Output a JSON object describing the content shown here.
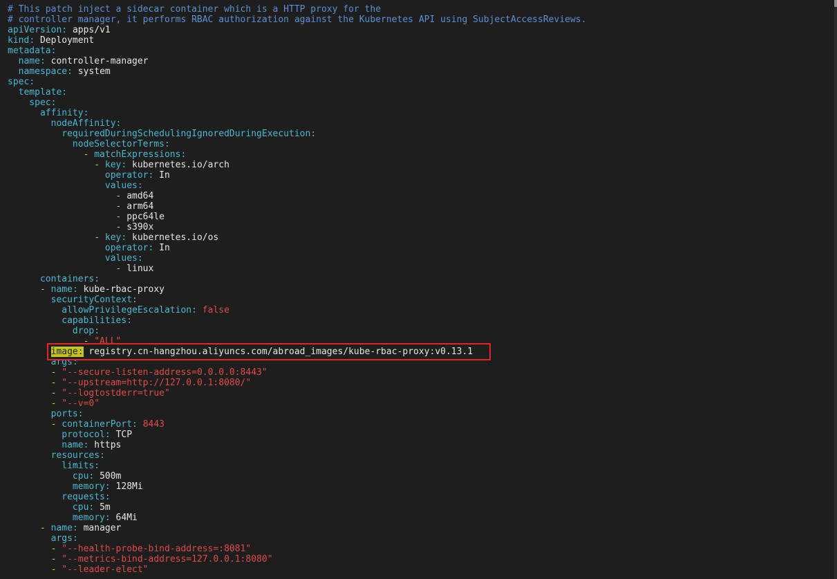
{
  "lines": [
    [
      {
        "t": "# This patch inject a sidecar container which is a HTTP proxy for the",
        "c": "cmt"
      }
    ],
    [
      {
        "t": "# controller manager, it performs RBAC authorization against the Kubernetes API using SubjectAccessReviews.",
        "c": "cmt"
      }
    ],
    [
      {
        "t": "apiVersion",
        "c": "key"
      },
      {
        "t": ": ",
        "c": "key"
      },
      {
        "t": "apps/v1",
        "c": "val"
      }
    ],
    [
      {
        "t": "kind",
        "c": "key"
      },
      {
        "t": ": ",
        "c": "key"
      },
      {
        "t": "Deployment",
        "c": "val"
      }
    ],
    [
      {
        "t": "metadata",
        "c": "key"
      },
      {
        "t": ":",
        "c": "key"
      }
    ],
    [
      {
        "t": "  "
      },
      {
        "t": "name",
        "c": "key"
      },
      {
        "t": ": ",
        "c": "key"
      },
      {
        "t": "controller-manager",
        "c": "val"
      }
    ],
    [
      {
        "t": "  "
      },
      {
        "t": "namespace",
        "c": "key"
      },
      {
        "t": ": ",
        "c": "key"
      },
      {
        "t": "system",
        "c": "val"
      }
    ],
    [
      {
        "t": "spec",
        "c": "key"
      },
      {
        "t": ":",
        "c": "key"
      }
    ],
    [
      {
        "t": "  "
      },
      {
        "t": "template",
        "c": "key"
      },
      {
        "t": ":",
        "c": "key"
      }
    ],
    [
      {
        "t": "    "
      },
      {
        "t": "spec",
        "c": "key"
      },
      {
        "t": ":",
        "c": "key"
      }
    ],
    [
      {
        "t": "      "
      },
      {
        "t": "affinity",
        "c": "key"
      },
      {
        "t": ":",
        "c": "key"
      }
    ],
    [
      {
        "t": "        "
      },
      {
        "t": "nodeAffinity",
        "c": "key"
      },
      {
        "t": ":",
        "c": "key"
      }
    ],
    [
      {
        "t": "          "
      },
      {
        "t": "requiredDuringSchedulingIgnoredDuringExecution",
        "c": "key"
      },
      {
        "t": ":",
        "c": "key"
      }
    ],
    [
      {
        "t": "            "
      },
      {
        "t": "nodeSelectorTerms",
        "c": "key"
      },
      {
        "t": ":",
        "c": "key"
      }
    ],
    [
      {
        "t": "              "
      },
      {
        "t": "- ",
        "c": "dash"
      },
      {
        "t": "matchExpressions",
        "c": "key"
      },
      {
        "t": ":",
        "c": "key"
      }
    ],
    [
      {
        "t": "                "
      },
      {
        "t": "- ",
        "c": "dash"
      },
      {
        "t": "key",
        "c": "key"
      },
      {
        "t": ": ",
        "c": "key"
      },
      {
        "t": "kubernetes.io/arch",
        "c": "val"
      }
    ],
    [
      {
        "t": "                  "
      },
      {
        "t": "operator",
        "c": "key"
      },
      {
        "t": ": ",
        "c": "key"
      },
      {
        "t": "In",
        "c": "val"
      }
    ],
    [
      {
        "t": "                  "
      },
      {
        "t": "values",
        "c": "key"
      },
      {
        "t": ":",
        "c": "key"
      }
    ],
    [
      {
        "t": "                    "
      },
      {
        "t": "- ",
        "c": "dash"
      },
      {
        "t": "amd64",
        "c": "val"
      }
    ],
    [
      {
        "t": "                    "
      },
      {
        "t": "- ",
        "c": "dash"
      },
      {
        "t": "arm64",
        "c": "val"
      }
    ],
    [
      {
        "t": "                    "
      },
      {
        "t": "- ",
        "c": "dash"
      },
      {
        "t": "ppc64le",
        "c": "val"
      }
    ],
    [
      {
        "t": "                    "
      },
      {
        "t": "- ",
        "c": "dash"
      },
      {
        "t": "s390x",
        "c": "val"
      }
    ],
    [
      {
        "t": "                "
      },
      {
        "t": "- ",
        "c": "dash"
      },
      {
        "t": "key",
        "c": "key"
      },
      {
        "t": ": ",
        "c": "key"
      },
      {
        "t": "kubernetes.io/os",
        "c": "val"
      }
    ],
    [
      {
        "t": "                  "
      },
      {
        "t": "operator",
        "c": "key"
      },
      {
        "t": ": ",
        "c": "key"
      },
      {
        "t": "In",
        "c": "val"
      }
    ],
    [
      {
        "t": "                  "
      },
      {
        "t": "values",
        "c": "key"
      },
      {
        "t": ":",
        "c": "key"
      }
    ],
    [
      {
        "t": "                    "
      },
      {
        "t": "- ",
        "c": "dash"
      },
      {
        "t": "linux",
        "c": "val"
      }
    ],
    [
      {
        "t": "      "
      },
      {
        "t": "containers",
        "c": "key"
      },
      {
        "t": ":",
        "c": "key"
      }
    ],
    [
      {
        "t": "      "
      },
      {
        "t": "- ",
        "c": "dash"
      },
      {
        "t": "name",
        "c": "key"
      },
      {
        "t": ": ",
        "c": "key"
      },
      {
        "t": "kube-rbac-proxy",
        "c": "val"
      }
    ],
    [
      {
        "t": "        "
      },
      {
        "t": "securityContext",
        "c": "key"
      },
      {
        "t": ":",
        "c": "key"
      }
    ],
    [
      {
        "t": "          "
      },
      {
        "t": "allowPrivilegeEscalation",
        "c": "key"
      },
      {
        "t": ": ",
        "c": "key"
      },
      {
        "t": "false",
        "c": "bool"
      }
    ],
    [
      {
        "t": "          "
      },
      {
        "t": "capabilities",
        "c": "key"
      },
      {
        "t": ":",
        "c": "key"
      }
    ],
    [
      {
        "t": "            "
      },
      {
        "t": "drop",
        "c": "key"
      },
      {
        "t": ":",
        "c": "key"
      }
    ],
    [
      {
        "t": "              "
      },
      {
        "t": "- ",
        "c": "dash"
      },
      {
        "t": "\"ALL\"",
        "c": "str"
      }
    ],
    [
      {
        "t": "        "
      },
      {
        "t": "image:",
        "c": "hl"
      },
      {
        "t": " "
      },
      {
        "t": "registry.cn-hangzhou.aliyuncs.com/abroad_images/kube-rbac-proxy:v0.13.1",
        "c": "val"
      }
    ],
    [
      {
        "t": "        "
      },
      {
        "t": "args",
        "c": "key"
      },
      {
        "t": ":",
        "c": "key"
      }
    ],
    [
      {
        "t": "        "
      },
      {
        "t": "- ",
        "c": "dash"
      },
      {
        "t": "\"--secure-listen-address=0.0.0.0:8443\"",
        "c": "str"
      }
    ],
    [
      {
        "t": "        "
      },
      {
        "t": "- ",
        "c": "dash"
      },
      {
        "t": "\"--upstream=http://127.0.0.1:8080/\"",
        "c": "str"
      }
    ],
    [
      {
        "t": "        "
      },
      {
        "t": "- ",
        "c": "dash"
      },
      {
        "t": "\"--logtostderr=true\"",
        "c": "str"
      }
    ],
    [
      {
        "t": "        "
      },
      {
        "t": "- ",
        "c": "dash"
      },
      {
        "t": "\"--v=0\"",
        "c": "str"
      }
    ],
    [
      {
        "t": "        "
      },
      {
        "t": "ports",
        "c": "key"
      },
      {
        "t": ":",
        "c": "key"
      }
    ],
    [
      {
        "t": "        "
      },
      {
        "t": "- ",
        "c": "dash"
      },
      {
        "t": "containerPort",
        "c": "key"
      },
      {
        "t": ": ",
        "c": "key"
      },
      {
        "t": "8443",
        "c": "num"
      }
    ],
    [
      {
        "t": "          "
      },
      {
        "t": "protocol",
        "c": "key"
      },
      {
        "t": ": ",
        "c": "key"
      },
      {
        "t": "TCP",
        "c": "val"
      }
    ],
    [
      {
        "t": "          "
      },
      {
        "t": "name",
        "c": "key"
      },
      {
        "t": ": ",
        "c": "key"
      },
      {
        "t": "https",
        "c": "val"
      }
    ],
    [
      {
        "t": "        "
      },
      {
        "t": "resources",
        "c": "key"
      },
      {
        "t": ":",
        "c": "key"
      }
    ],
    [
      {
        "t": "          "
      },
      {
        "t": "limits",
        "c": "key"
      },
      {
        "t": ":",
        "c": "key"
      }
    ],
    [
      {
        "t": "            "
      },
      {
        "t": "cpu",
        "c": "key"
      },
      {
        "t": ": ",
        "c": "key"
      },
      {
        "t": "500m",
        "c": "val"
      }
    ],
    [
      {
        "t": "            "
      },
      {
        "t": "memory",
        "c": "key"
      },
      {
        "t": ": ",
        "c": "key"
      },
      {
        "t": "128Mi",
        "c": "val"
      }
    ],
    [
      {
        "t": "          "
      },
      {
        "t": "requests",
        "c": "key"
      },
      {
        "t": ":",
        "c": "key"
      }
    ],
    [
      {
        "t": "            "
      },
      {
        "t": "cpu",
        "c": "key"
      },
      {
        "t": ": ",
        "c": "key"
      },
      {
        "t": "5m",
        "c": "val"
      }
    ],
    [
      {
        "t": "            "
      },
      {
        "t": "memory",
        "c": "key"
      },
      {
        "t": ": ",
        "c": "key"
      },
      {
        "t": "64Mi",
        "c": "val"
      }
    ],
    [
      {
        "t": "      "
      },
      {
        "t": "- ",
        "c": "dash"
      },
      {
        "t": "name",
        "c": "key"
      },
      {
        "t": ": ",
        "c": "key"
      },
      {
        "t": "manager",
        "c": "val"
      }
    ],
    [
      {
        "t": "        "
      },
      {
        "t": "args",
        "c": "key"
      },
      {
        "t": ":",
        "c": "key"
      }
    ],
    [
      {
        "t": "        "
      },
      {
        "t": "- ",
        "c": "dash"
      },
      {
        "t": "\"--health-probe-bind-address=:8081\"",
        "c": "str"
      }
    ],
    [
      {
        "t": "        "
      },
      {
        "t": "- ",
        "c": "dash"
      },
      {
        "t": "\"--metrics-bind-address=127.0.0.1:8080\"",
        "c": "str"
      }
    ],
    [
      {
        "t": "        "
      },
      {
        "t": "- ",
        "c": "dash"
      },
      {
        "t": "\"--leader-elect\"",
        "c": "str"
      }
    ]
  ],
  "highlight": {
    "line_index": 33,
    "color": "#e0262b",
    "label": "image:"
  },
  "colors": {
    "background": "#1e1e1e",
    "comment": "#5b8fd6",
    "key": "#47b8d1",
    "string": "#e04848",
    "dash": "#cfcf35",
    "value": "#e6e6e6",
    "search_highlight": "#c6c61a"
  }
}
